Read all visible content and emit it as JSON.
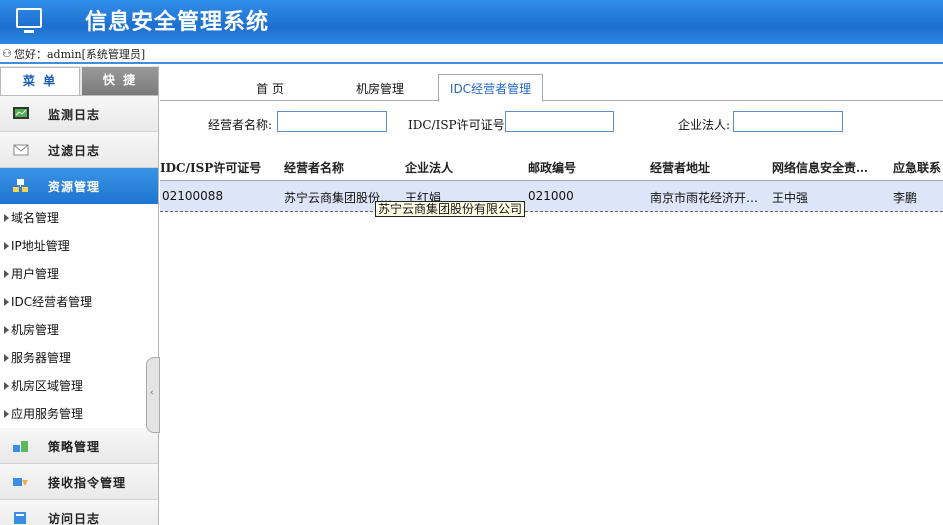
{
  "app": {
    "title": "信息安全管理系统"
  },
  "userbar": {
    "greeting": "您好：admin[系统管理员]"
  },
  "sidebar": {
    "tabs": [
      {
        "label": "菜 单"
      },
      {
        "label": "快 捷"
      }
    ],
    "groups": [
      {
        "label": "监测日志",
        "icon": "monitor-log-icon"
      },
      {
        "label": "过滤日志",
        "icon": "envelope-icon"
      },
      {
        "label": "资源管理",
        "icon": "resource-icon"
      },
      {
        "label": "策略管理",
        "icon": "policy-icon"
      },
      {
        "label": "接收指令管理",
        "icon": "command-icon"
      },
      {
        "label": "访问日志",
        "icon": "access-log-icon"
      }
    ],
    "subitems": [
      "域名管理",
      "IP地址管理",
      "用户管理",
      "IDC经营者管理",
      "机房管理",
      "服务器管理",
      "机房区域管理",
      "应用服务管理"
    ]
  },
  "main": {
    "tabs": [
      {
        "label": "首 页"
      },
      {
        "label": "机房管理"
      },
      {
        "label": "IDC经营者管理"
      }
    ],
    "filters": {
      "operator_name_label": "经营者名称:",
      "license_label": "IDC/ISP许可证号:",
      "legal_person_label": "企业法人:"
    },
    "table": {
      "columns": [
        "IDC/ISP许可证号",
        "经营者名称",
        "企业法人",
        "邮政编号",
        "经营者地址",
        "网络信息安全责…",
        "应急联系"
      ],
      "rows": [
        {
          "license": "02100088",
          "name": "苏宁云商集团股份…",
          "legal": "王红娟",
          "zip": "021000",
          "address": "南京市雨花经济开…",
          "security": "王中强",
          "emergency": "李鹏"
        }
      ]
    },
    "tooltip": "苏宁云商集团股份有限公司"
  },
  "colors": {
    "header": "#1e6fcf",
    "active_menu": "#2a82dc",
    "row_highlight": "#dde6f8"
  }
}
